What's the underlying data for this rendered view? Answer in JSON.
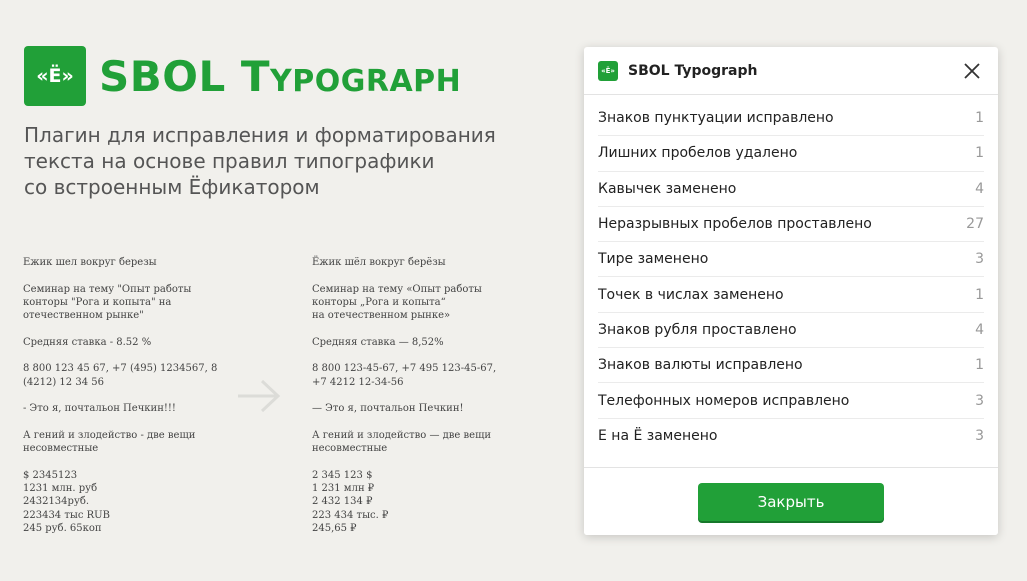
{
  "brand": {
    "logo_text": "«Ё»",
    "title_first": "SBOL",
    "title_t": "T",
    "title_rest": "YPOGRAPH",
    "tagline": "Плагин для исправления и форматирования\nтекста на основе правил типографики\nсо встроенным Ёфикатором"
  },
  "sample_before": [
    "Ежик шел вокруг березы",
    "Семинар на тему \"Опыт работы\nконторы \"Рога и копыта\" на\nотечественном рынке\"",
    "Средняя ставка - 8.52 %",
    "8 800 123 45 67, +7 (495) 1234567, 8\n(4212) 12 34 56",
    "- Это я, почтальон Печкин!!!",
    "А гений и злодейство - две вещи\nнесовместные",
    "$ 2345123\n1231 млн. руб\n2432134руб.\n223434 тыс RUB\n245 руб. 65коп"
  ],
  "sample_after": [
    "Ёжик шёл вокруг берёзы",
    "Семинар на тему «Опыт работы\nконторы „Рога и копыта“\nна отечественном рынке»",
    "Средняя ставка — 8,52%",
    "8 800 123-45-67, +7 495 123-45-67,\n+7 4212 12-34-56",
    "— Это я, почтальон Печкин!",
    "А гений и злодейство — две вещи\nнесовместные",
    "2 345 123 $\n1 231 млн ₽\n2 432 134 ₽\n223 434 тыс. ₽\n245,65 ₽"
  ],
  "dialog": {
    "logo_text": "«Ё»",
    "title": "SBOL Typograph",
    "stats": [
      {
        "label": "Знаков пунктуации исправлено",
        "value": "1"
      },
      {
        "label": "Лишних пробелов удалено",
        "value": "1"
      },
      {
        "label": "Кавычек заменено",
        "value": "4"
      },
      {
        "label": "Неразрывных пробелов проставлено",
        "value": "27"
      },
      {
        "label": "Тире заменено",
        "value": "3"
      },
      {
        "label": "Точек в числах заменено",
        "value": "1"
      },
      {
        "label": "Знаков рубля проставлено",
        "value": "4"
      },
      {
        "label": "Знаков валюты исправлено",
        "value": "1"
      },
      {
        "label": "Телефонных номеров исправлено",
        "value": "3"
      },
      {
        "label": "Е на Ё заменено",
        "value": "3"
      }
    ],
    "close_button": "Закрыть"
  },
  "colors": {
    "accent": "#21a038",
    "background": "#f1f0ec"
  }
}
